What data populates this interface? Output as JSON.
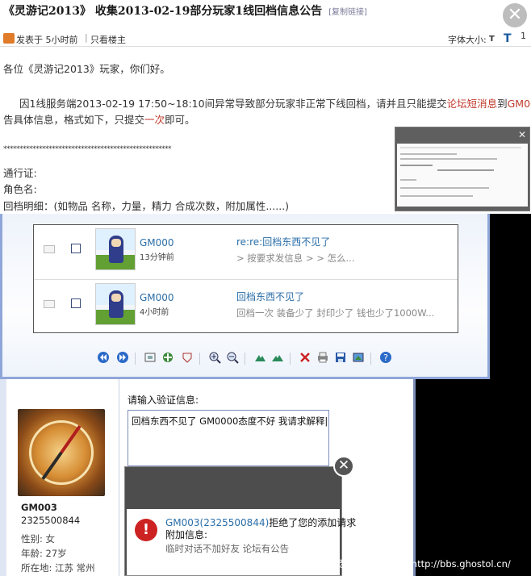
{
  "post": {
    "title": "《灵游记2013》 收集2013-02-19部分玩家1线回档信息公告",
    "copy_link": "[复制链接]",
    "posted": "发表于  5小时前",
    "separator": "|",
    "only_author": "只看楼主",
    "font_size_label": "字体大小:",
    "font_small": "T",
    "font_large": "T",
    "font_extra": "1",
    "greeting": "各位《灵游记2013》玩家，你们好。",
    "p1_a": "因1线服务端2013-02-19 17:50~18:10间异常导致部分玩家非正常下线回档，请并且只能提交",
    "p1_link1": "论坛短消息",
    "p1_b": "到",
    "p1_link2": "GM000",
    "p1_c": "报",
    "p2_a": "告具体信息，格式如下，只提交",
    "p2_link": "一次",
    "p2_b": "即可。",
    "stars": "****************************************************",
    "field_account": "通行证:",
    "field_role": "角色名:",
    "field_detail": "回档明细：(如物品 名称，力量，精力 合成次数，附加属性......)",
    "thumb_close": "✕"
  },
  "messages": {
    "rows": [
      {
        "sender": "GM000",
        "time": "13分钟前",
        "subject": "re:re:回档东西不见了",
        "preview": "> 按要求发信息 > > 怎么..."
      },
      {
        "sender": "GM000",
        "time": "4小时前",
        "subject": "回档东西不见了",
        "preview": "回档一次 装备少了 封印少了 钱也少了1000W..."
      }
    ],
    "toolbar_icons": [
      "first-page-icon",
      "next-page-icon",
      "fit-window-icon",
      "fit-icon",
      "view-icon",
      "zoom-in-icon",
      "zoom-out-icon",
      "rotate-left-icon",
      "rotate-right-icon",
      "delete-icon",
      "print-icon",
      "save-icon",
      "edit-icon",
      "help-icon"
    ]
  },
  "profile": {
    "name": "GM003",
    "id": "2325500844",
    "gender": "性别: 女",
    "age": "年龄: 27岁",
    "location": "所在地: 江苏  常州"
  },
  "verify": {
    "label": "请输入验证信息:",
    "value": "回档东西不见了 GM0000态度不好 我请求解释|"
  },
  "dialog": {
    "close": "✕",
    "error_icon": "!",
    "who": "GM003(2325500844)",
    "message": "拒绝了您的添加请求",
    "extra_label": "附加信息:",
    "extra_value": "临时对话不加好友 论坛有公告"
  },
  "watermark": "2013-02-20 16:03:58上传于《灵游记》官方论坛 http://bbs.ghostol.cn/"
}
